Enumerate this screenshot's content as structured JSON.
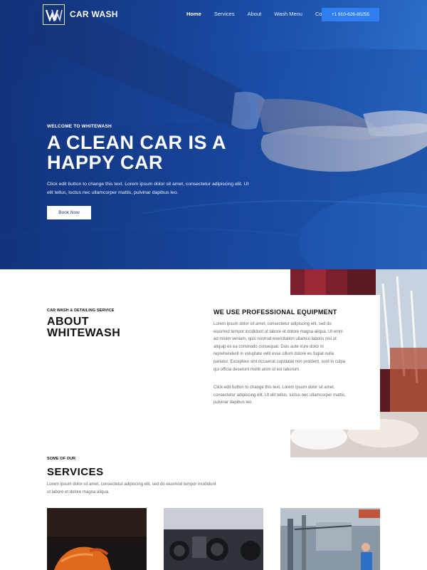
{
  "nav": {
    "logo_text": "CAR WASH",
    "links": [
      {
        "label": "Home",
        "active": true
      },
      {
        "label": "Services",
        "active": false
      },
      {
        "label": "About",
        "active": false
      },
      {
        "label": "Wash Menu",
        "active": false
      },
      {
        "label": "Contact",
        "active": false
      }
    ],
    "phone": "+1 910-626-85255"
  },
  "hero": {
    "welcome": "WELCOME TO WHITEWASH",
    "title": "A CLEAN CAR IS A HAPPY CAR",
    "text": "Click edit button to change this text. Lorem ipsum dolor sit amet, consectetur adipiscing elit. Ut elit tellus, luctus nec ullamcorper mattis, pulvinar dapibus leo.",
    "button": "Book Now"
  },
  "about": {
    "eyebrow": "CAR WASH & DETAILING SERVICE",
    "title": "ABOUT WHITEWASH",
    "card_heading": "WE USE PROFESSIONAL EQUIPMENT",
    "paragraph1": "Lorem ipsum dolor sit amet, consectetur adipiscing elit, sed do eiusmod tempor incididunt ut labore et dolore magna aliqua. Ut enim ad minim veniam, quis nostrud exercitation ullamco laboris nisi ut aliquip ex ea commodo consequat. Duis aute irure dolor in reprehenderit in voluptate velit esse cillum dolore eu fugiat nulla pariatur. Excepteur sint occaecat cupidatat non proident, sunt in culpa qui officia deserunt mollit anim id est laborum.",
    "paragraph2": "Click edit button to change this text. Lorem ipsum dolor sit amet, consectetur adipiscing elit. Ut elit tellus, luctus nec ullamcorper mattis, pulvinar dapibus leo."
  },
  "services": {
    "eyebrow": "SOME OF OUR",
    "title": "SERVICES",
    "text": "Lorem ipsum dolor sit amet, consectetur adipiscing elit, sed do eiusmod tempor incididunt ut labore et dolore magna aliqua."
  },
  "colors": {
    "brand_blue": "#1b4fa6",
    "phone_button": "#2f7ff0",
    "text_dark": "#111111",
    "text_muted": "#666666"
  },
  "icons": [
    "logo-monogram-icon"
  ]
}
